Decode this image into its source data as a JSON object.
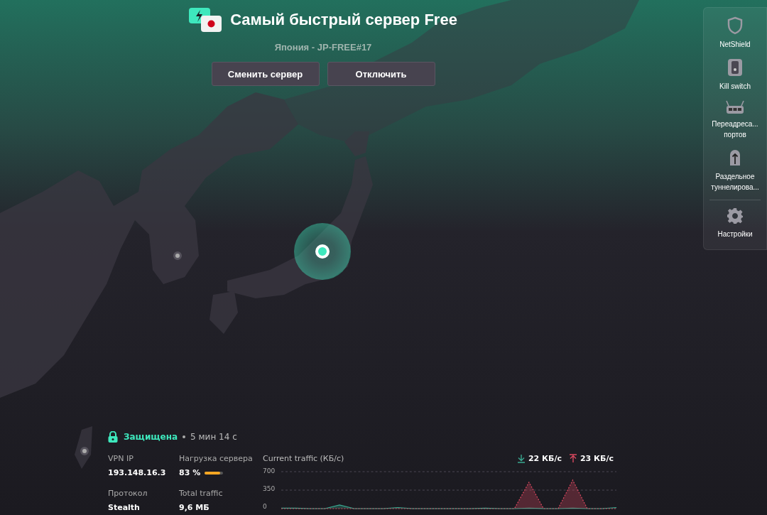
{
  "header": {
    "title": "Самый быстрый сервер Free",
    "subtitle": "Япония - JP-FREE#17",
    "buttons": [
      {
        "label": "Сменить сервер"
      },
      {
        "label": "Отключить"
      }
    ]
  },
  "sidebar": {
    "items": [
      {
        "kind": "shield",
        "label": "NetShield"
      },
      {
        "kind": "switch",
        "label": "Kill switch"
      },
      {
        "kind": "router",
        "label": "Переадреса... портов"
      },
      {
        "kind": "tunnel",
        "label": "Раздельное туннелирова..."
      }
    ],
    "settings": {
      "kind": "gear",
      "label": "Настройки"
    }
  },
  "status": {
    "state": "Защищена",
    "duration": "5 мин 14 с"
  },
  "stats": [
    {
      "label": "VPN IP",
      "value": "193.148.16.3"
    },
    {
      "label": "Нагрузка сервера",
      "value": "83 %",
      "level": 0.83
    },
    {
      "label": "Протокол",
      "value": "Stealth"
    },
    {
      "label": "Total traffic",
      "value": "9,6 МБ"
    }
  ],
  "traffic": {
    "download": "22 КБ/с",
    "upload": "23 КБ/с",
    "chart_data": {
      "type": "area",
      "title": "Current traffic (КБ/с)",
      "ylim": [
        0,
        700
      ],
      "yticks": [
        0,
        350,
        700
      ],
      "series": [
        {
          "color": "#3aa890",
          "values": [
            10,
            10,
            0,
            0,
            70,
            0,
            0,
            0,
            20,
            0,
            0,
            0,
            0,
            0,
            10,
            0,
            0,
            10,
            0,
            0,
            10,
            0,
            0,
            20
          ]
        },
        {
          "color": "#d9485f",
          "values": [
            0,
            0,
            0,
            0,
            0,
            0,
            0,
            0,
            0,
            0,
            0,
            0,
            0,
            0,
            0,
            0,
            0,
            500,
            0,
            0,
            540,
            0,
            0,
            0
          ]
        }
      ]
    }
  }
}
